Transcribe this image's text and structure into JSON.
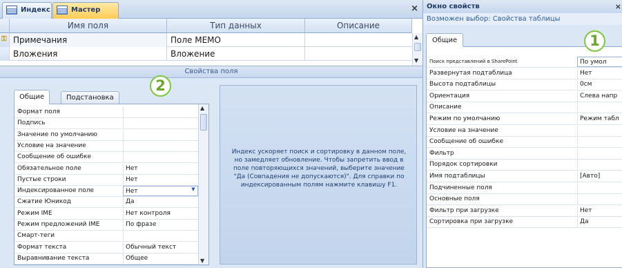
{
  "tabs": {
    "index_label": "Индекс",
    "master_label": "Мастер",
    "close_glyph": "×"
  },
  "grid": {
    "headers": {
      "name": "Имя поля",
      "type": "Тип данных",
      "description": "Описание"
    },
    "rows": [
      {
        "name": "Примечания",
        "type": "Поле MEMO",
        "description": "",
        "selected": true
      },
      {
        "name": "Вложения",
        "type": "Вложение",
        "description": "",
        "selected": false
      }
    ],
    "section_label": "Свойства поля"
  },
  "field_props": {
    "tabs": {
      "general": "Общие",
      "lookup": "Подстановка"
    },
    "rows": [
      {
        "label": "Формат поля",
        "value": ""
      },
      {
        "label": "Подпись",
        "value": ""
      },
      {
        "label": "Значение по умолчанию",
        "value": ""
      },
      {
        "label": "Условие на значение",
        "value": ""
      },
      {
        "label": "Сообщение об ошибке",
        "value": ""
      },
      {
        "label": "Обязательное поле",
        "value": "Нет"
      },
      {
        "label": "Пустые строки",
        "value": "Нет"
      },
      {
        "label": "Индексированное поле",
        "value": "Нет"
      },
      {
        "label": "Сжатие Юникод",
        "value": "Да"
      },
      {
        "label": "Режим IME",
        "value": "Нет контроля"
      },
      {
        "label": "Режим предложений IME",
        "value": "По фразе"
      },
      {
        "label": "Смарт-теги",
        "value": ""
      },
      {
        "label": "Формат текста",
        "value": "Обычный текст"
      },
      {
        "label": "Выравнивание текста",
        "value": "Общее"
      }
    ],
    "active_row": 7,
    "help_text": "Индекс ускоряет поиск и сортировку в данном поле, но замедляет обновление. Чтобы запретить ввод в поле повторяющихся значений, выберите значение \"Да (Совпадения не допускаются)\". Для справки по индексированным полям нажмите клавишу F1."
  },
  "callouts": {
    "one": "1",
    "two": "2"
  },
  "property_sheet": {
    "title": "Окно свойств",
    "close_glyph": "×",
    "selection_line": "Возможен выбор:  Свойства таблицы",
    "tab_general": "Общие",
    "rows": [
      {
        "label": "Поиск представлений в SharePoint",
        "value": "По умол",
        "small": true
      },
      {
        "label": "Развернутая подтаблица",
        "value": "Нет"
      },
      {
        "label": "Высота подтаблицы",
        "value": "0см"
      },
      {
        "label": "Ориентация",
        "value": "Слева напр"
      },
      {
        "label": "Описание",
        "value": ""
      },
      {
        "label": "Режим по умолчанию",
        "value": "Режим табл"
      },
      {
        "label": "Условие на значение",
        "value": ""
      },
      {
        "label": "Сообщение об ошибке",
        "value": ""
      },
      {
        "label": "Фильтр",
        "value": ""
      },
      {
        "label": "Порядок сортировки",
        "value": ""
      },
      {
        "label": "Имя подтаблицы",
        "value": "[Авто]"
      },
      {
        "label": "Подчиненные поля",
        "value": ""
      },
      {
        "label": "Основные поля",
        "value": ""
      },
      {
        "label": "Фильтр при загрузке",
        "value": "Нет"
      },
      {
        "label": "Сортировка при загрузке",
        "value": "Да"
      }
    ]
  }
}
